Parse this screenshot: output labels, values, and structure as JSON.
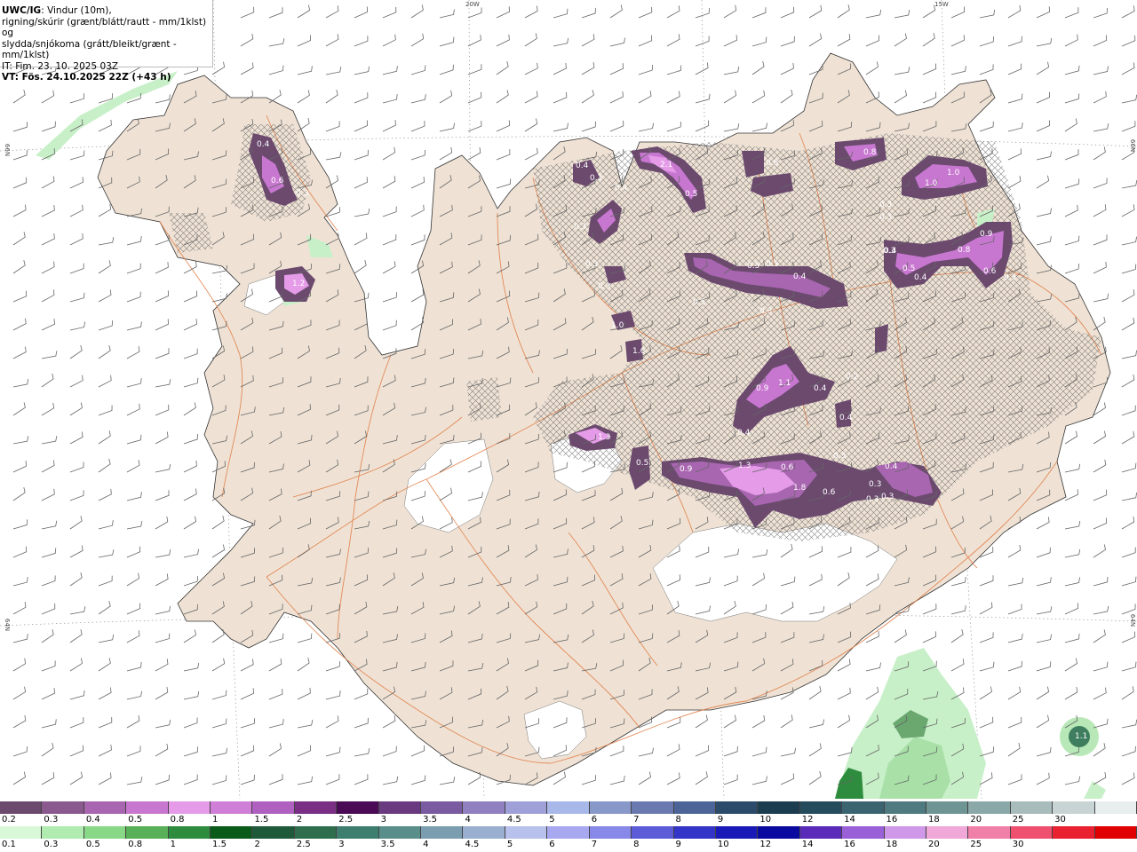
{
  "header": {
    "model": "UWC/IG",
    "line1": ": Vindur (10m),",
    "line2": "rigning/skúrir (grænt/blátt/rautt - mm/1klst) og",
    "line3": "slydda/snjókoma (grátt/bleikt/grænt - mm/1klst)",
    "it": "IT: Fim. 23. 10. 2025 03Z",
    "vt": "VT: Fös. 24.10.2025 22Z (+43 h)"
  },
  "graticule": {
    "top_labels": [
      "20W",
      "15W"
    ],
    "side_labels": [
      "66N",
      "64N"
    ]
  },
  "precip_values": [
    "0.4",
    "0.6",
    "0.3",
    "1.2",
    "0.4",
    "0.3",
    "0.3",
    "0.3",
    "0.3",
    "0.5",
    "1.0",
    "1.6",
    "2.1",
    "0.5",
    "0.4",
    "0.8",
    "0.5",
    "0.5",
    "0.4",
    "0.3",
    "0.3",
    "0.8",
    "1.0",
    "1.0",
    "0.3",
    "0.3",
    "0.4",
    "0.5",
    "0.4",
    "0.8",
    "0.9",
    "0.6",
    "0.3",
    "0.9",
    "1.1",
    "0.4",
    "0.4",
    "0.4",
    "1.3",
    "0.5",
    "0.9",
    "1.3",
    "0.6",
    "1.8",
    "0.6",
    "0.3",
    "0.3",
    "0.3",
    "0.4",
    "0.3",
    "0.2",
    "1.1"
  ],
  "legend": {
    "snow": {
      "labels": [
        "0.2",
        "0.3",
        "0.4",
        "0.5",
        "0.8",
        "1",
        "1.5",
        "2",
        "2.5",
        "3",
        "3.5",
        "4",
        "4.5",
        "5",
        "6",
        "7",
        "8",
        "9",
        "10",
        "12",
        "14",
        "16",
        "18",
        "20",
        "25",
        "30"
      ],
      "colors": [
        "#6b4a6e",
        "#8a5a8e",
        "#a866b0",
        "#c877d0",
        "#e59be8",
        "#d07fd8",
        "#b060c0",
        "#7a2f85",
        "#4a0a55",
        "#6a3a80",
        "#7a5aa0",
        "#9080c0",
        "#a0a0d8",
        "#a8b8e8",
        "#8898c8",
        "#6a7ab0",
        "#4c6498",
        "#2c4a6a",
        "#1c3c50",
        "#254c5c",
        "#3a6470",
        "#4f7a80",
        "#6e9494",
        "#8aa8a8",
        "#a8bcbc",
        "#c8d4d4",
        "#e8eeee"
      ]
    },
    "rain": {
      "labels": [
        "0.1",
        "0.3",
        "0.5",
        "0.8",
        "1",
        "1.5",
        "2",
        "2.5",
        "3",
        "3.5",
        "4",
        "4.5",
        "5",
        "6",
        "7",
        "8",
        "9",
        "10",
        "12",
        "14",
        "16",
        "18",
        "20",
        "25",
        "30"
      ],
      "colors": [
        "#d8f8d8",
        "#b0ecb0",
        "#88d888",
        "#58b058",
        "#2e8c3e",
        "#0a5a1a",
        "#1e5a3a",
        "#2e6e4e",
        "#3e7e6e",
        "#5a8e8a",
        "#7a9eb0",
        "#9aaed0",
        "#b8c0ec",
        "#a8a8f0",
        "#8888e8",
        "#5c5cd8",
        "#3434c8",
        "#1a1ab8",
        "#0a0aa0",
        "#5a2ab8",
        "#9a60d8",
        "#d098e8",
        "#f0a8d8",
        "#f080a8",
        "#f05070",
        "#e82030",
        "#e00000"
      ]
    }
  }
}
